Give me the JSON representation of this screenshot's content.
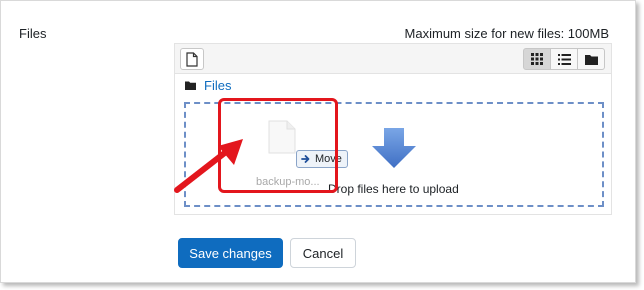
{
  "field": {
    "label": "Files",
    "max_size_text": "Maximum size for new files: 100MB"
  },
  "filepicker": {
    "add_icon": "add-file-icon",
    "views": [
      {
        "name": "icons-view",
        "icon": "grid-icon",
        "active": true
      },
      {
        "name": "list-view",
        "icon": "list-icon",
        "active": false
      },
      {
        "name": "tree-view",
        "icon": "folder-icon",
        "active": false
      }
    ],
    "path_label": "Files",
    "dropzone_text": "Drop files here to upload",
    "dragged_file": {
      "name": "backup-mo...",
      "move_label": "Move"
    }
  },
  "annotation": {
    "highlight_color": "#e3161d"
  },
  "actions": {
    "save_label": "Save changes",
    "cancel_label": "Cancel"
  },
  "colors": {
    "primary": "#0f6cbf",
    "dropzone_border": "#6d8fc7",
    "drop_arrow": "#5b8bd6"
  }
}
